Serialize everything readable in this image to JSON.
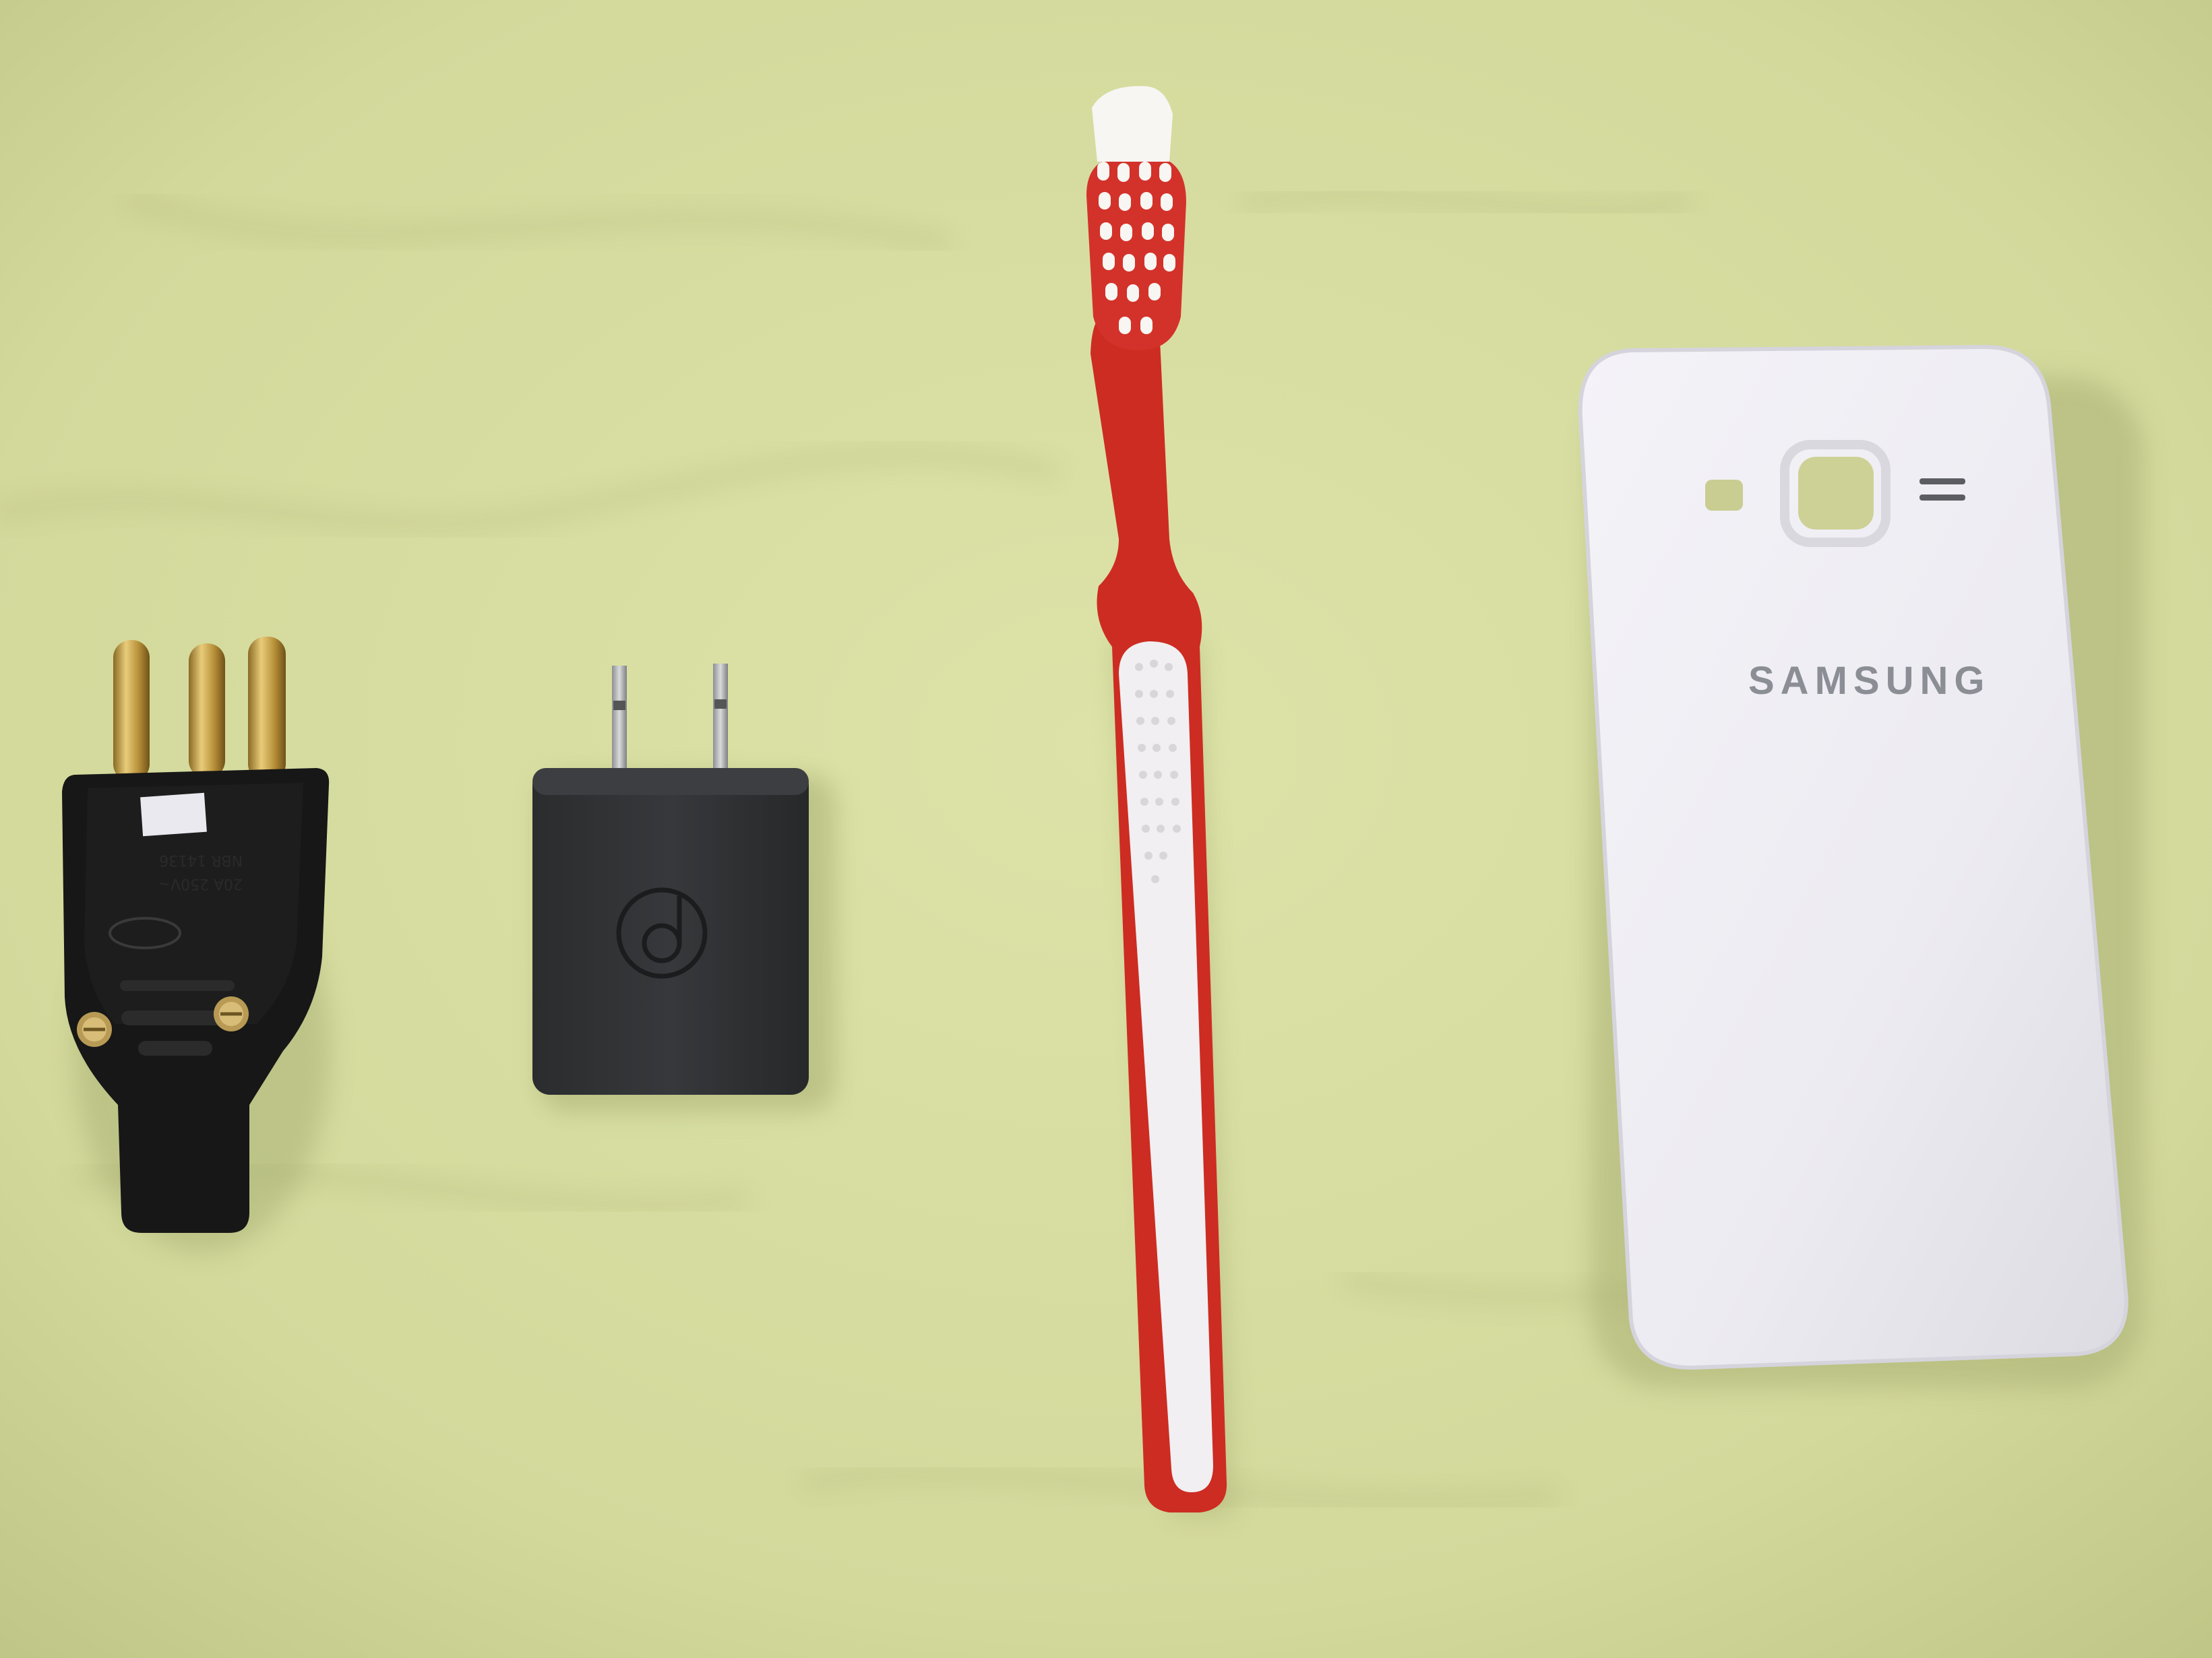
{
  "scene": {
    "description_colors": {
      "cloth": "#d7dca0",
      "cloth_shadow": "#b9bf84",
      "black_plastic": "#181818",
      "adapter": "#2f3133",
      "brass": "#c9a44a",
      "brush_red": "#cf2e23",
      "grip_white": "#f2f0f2",
      "cover_white": "#eeedf2"
    },
    "objects": [
      {
        "name": "three-pin-plug",
        "label": "3-pin plug"
      },
      {
        "name": "usb-wall-adapter",
        "label": "wall adapter"
      },
      {
        "name": "toothbrush",
        "label": "toothbrush"
      },
      {
        "name": "phone-back-cover",
        "label": "phone back cover"
      }
    ],
    "phone_cover": {
      "brand_text": "SAMSUNG"
    },
    "plug": {
      "molded_text_line1": "20A 250V~",
      "molded_text_line2": "NBR 14136"
    }
  }
}
